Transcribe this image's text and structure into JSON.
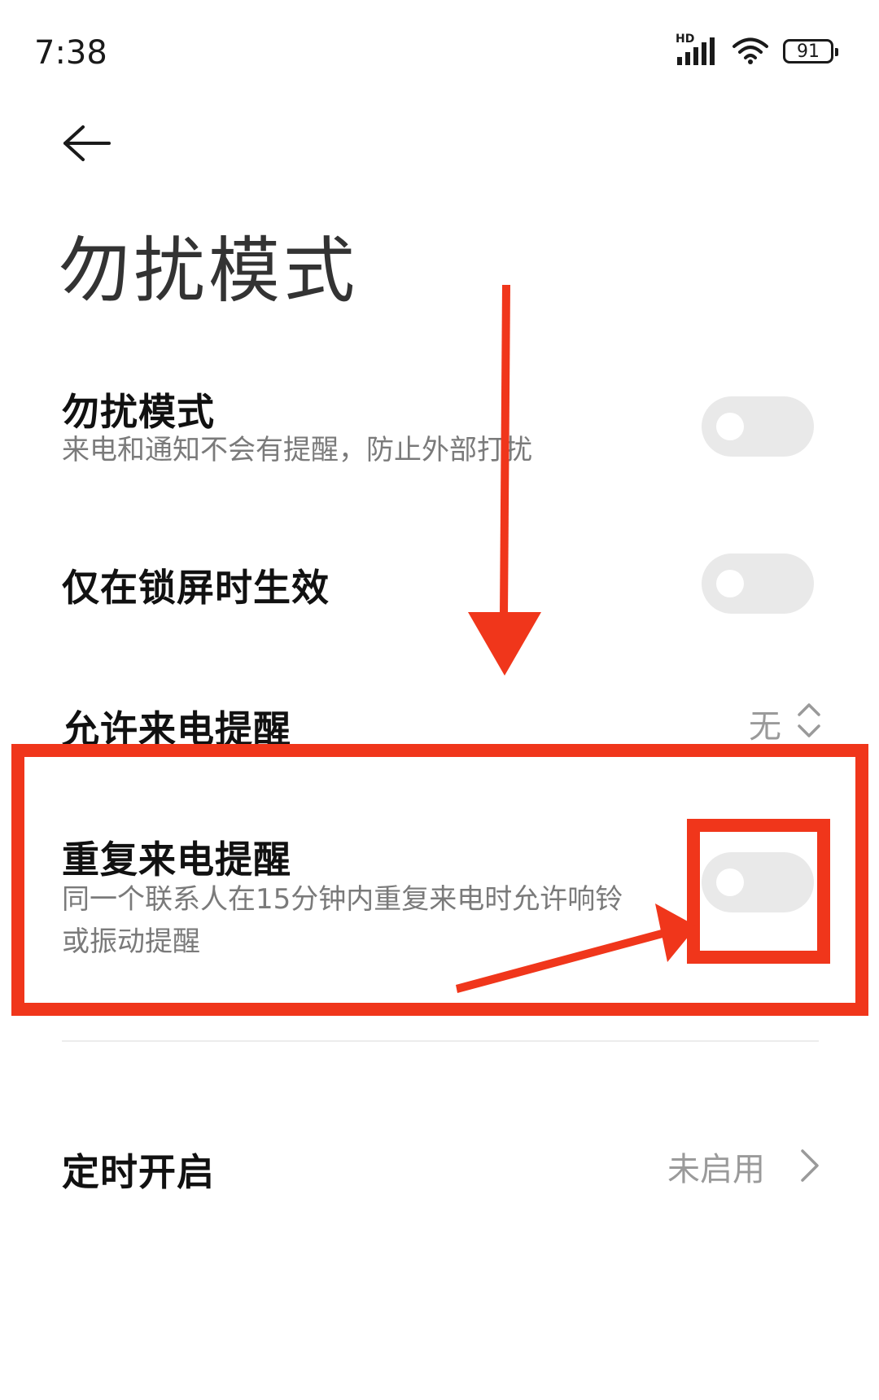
{
  "status_bar": {
    "time": "7:38",
    "network_label": "HD",
    "battery_level": "91"
  },
  "header": {
    "title": "勿扰模式"
  },
  "settings": {
    "dnd": {
      "label": "勿扰模式",
      "description": "来电和通知不会有提醒，防止外部打扰",
      "enabled": false
    },
    "lock_screen_only": {
      "label": "仅在锁屏时生效",
      "enabled": false
    },
    "allow_calls": {
      "label": "允许来电提醒",
      "value": "无"
    },
    "repeat_calls": {
      "label": "重复来电提醒",
      "description_line1": "同一个联系人在15分钟内重复来电时允许响铃",
      "description_line2": "或振动提醒",
      "enabled": false
    },
    "schedule": {
      "label": "定时开启",
      "value": "未启用"
    }
  },
  "colors": {
    "annotation": "#f0361b",
    "toggle_off": "#e9e9e9",
    "secondary_text": "#7a7a7a"
  }
}
